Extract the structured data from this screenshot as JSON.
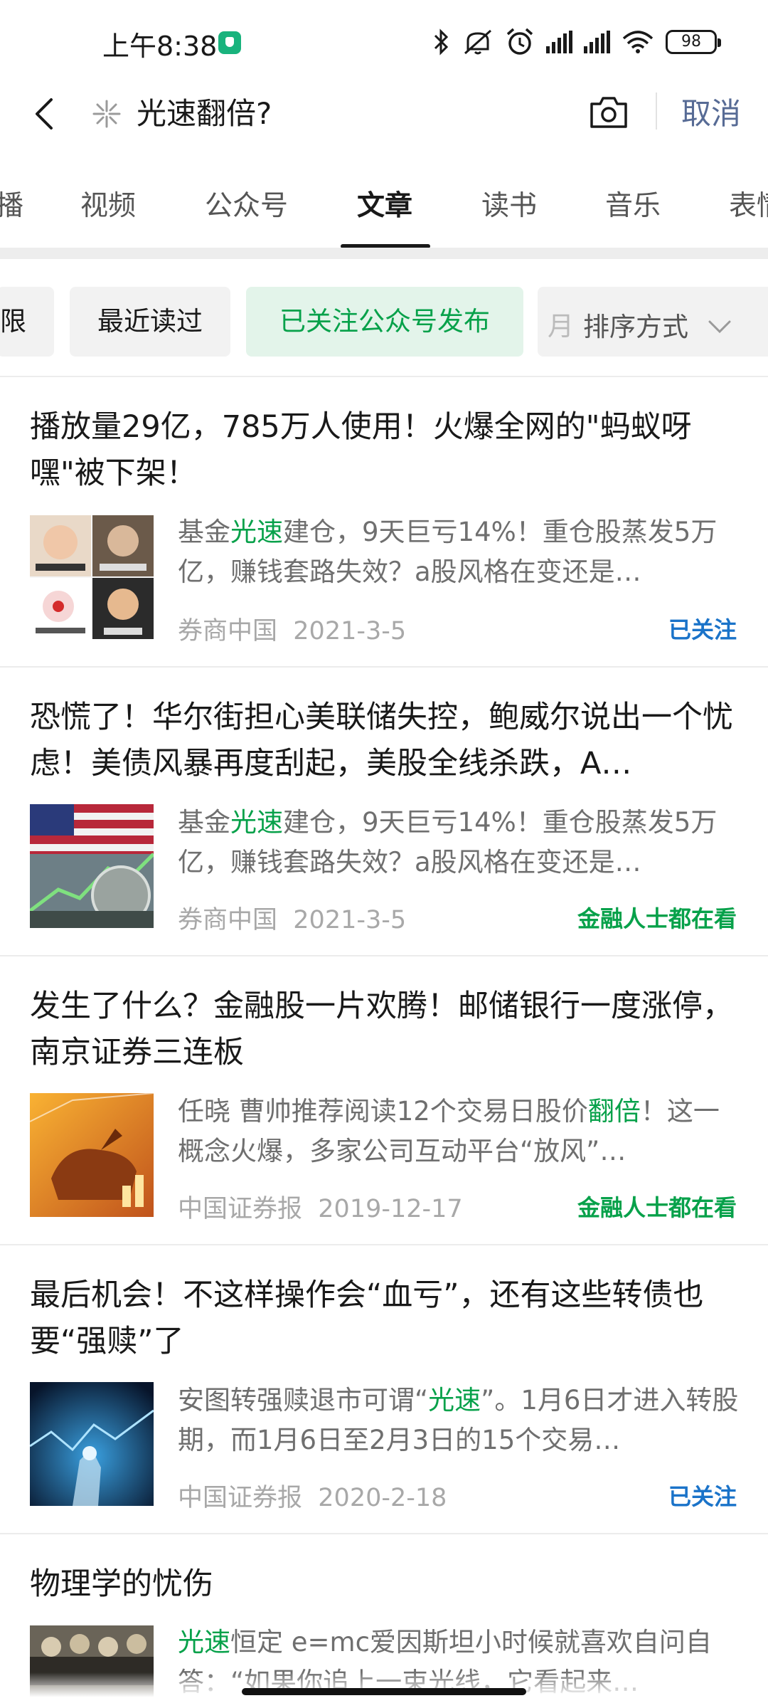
{
  "status_bar": {
    "time": "上午8:38",
    "battery": "98"
  },
  "search": {
    "query": "光速翻倍?",
    "cancel_label": "取消"
  },
  "tabs": [
    {
      "label": "播"
    },
    {
      "label": "视频"
    },
    {
      "label": "公众号"
    },
    {
      "label": "文章"
    },
    {
      "label": "读书"
    },
    {
      "label": "音乐"
    },
    {
      "label": "表情"
    }
  ],
  "active_tab": "文章",
  "filters": {
    "chip_partial": "限",
    "chip_recent": "最近读过",
    "chip_followed": "已关注公众号发布",
    "sort_partial": "月",
    "sort_label": "排序方式"
  },
  "articles": [
    {
      "title": "播放量29亿，785万人使用！火爆全网的\"蚂蚁呀嘿\"被下架！",
      "snippet_before": "基金",
      "snippet_highlight": "光速",
      "snippet_after": "建仓，9天巨亏14%！重仓股蒸发5万亿，赚钱套路失效？a股风格在变还是…",
      "source": "券商中国",
      "date": "2021-3-5",
      "badge": "已关注",
      "badge_color": "#1a73c9"
    },
    {
      "title": "恐慌了！华尔街担心美联储失控，鲍威尔说出一个忧虑！美债风暴再度刮起，美股全线杀跌，A…",
      "snippet_before": "基金",
      "snippet_highlight": "光速",
      "snippet_after": "建仓，9天巨亏14%！重仓股蒸发5万亿，赚钱套路失效？a股风格在变还是…",
      "source": "券商中国",
      "date": "2021-3-5",
      "badge": "金融人士都在看",
      "badge_color": "#07a14a"
    },
    {
      "title": "发生了什么？金融股一片欢腾！邮储银行一度涨停，南京证券三连板",
      "snippet_before": "任晓 曹帅推荐阅读12个交易日股价",
      "snippet_highlight": "翻倍",
      "snippet_after": "！这一概念火爆，多家公司互动平台“放风”…",
      "source": "中国证券报",
      "date": "2019-12-17",
      "badge": "金融人士都在看",
      "badge_color": "#07a14a"
    },
    {
      "title": "最后机会！不这样操作会“血亏”，还有这些转债也要“强赎”了",
      "snippet_before": "安图转强赎退市可谓“",
      "snippet_highlight": "光速",
      "snippet_after": "”。1月6日才进入转股期，而1月6日至2月3日的15个交易…",
      "source": "中国证券报",
      "date": "2020-2-18",
      "badge": "已关注",
      "badge_color": "#1a73c9"
    },
    {
      "title": "物理学的忧伤",
      "snippet_before": "",
      "snippet_highlight": "光速",
      "snippet_after": "恒定 e=mc爱因斯坦小时候就喜欢自问自答：“如果你追上一束光线，它看起来…",
      "source": "",
      "date": "",
      "badge": "",
      "badge_color": "#1a73c9"
    }
  ],
  "colors": {
    "accent_green": "#07a14a",
    "link_blue": "#576b95"
  }
}
